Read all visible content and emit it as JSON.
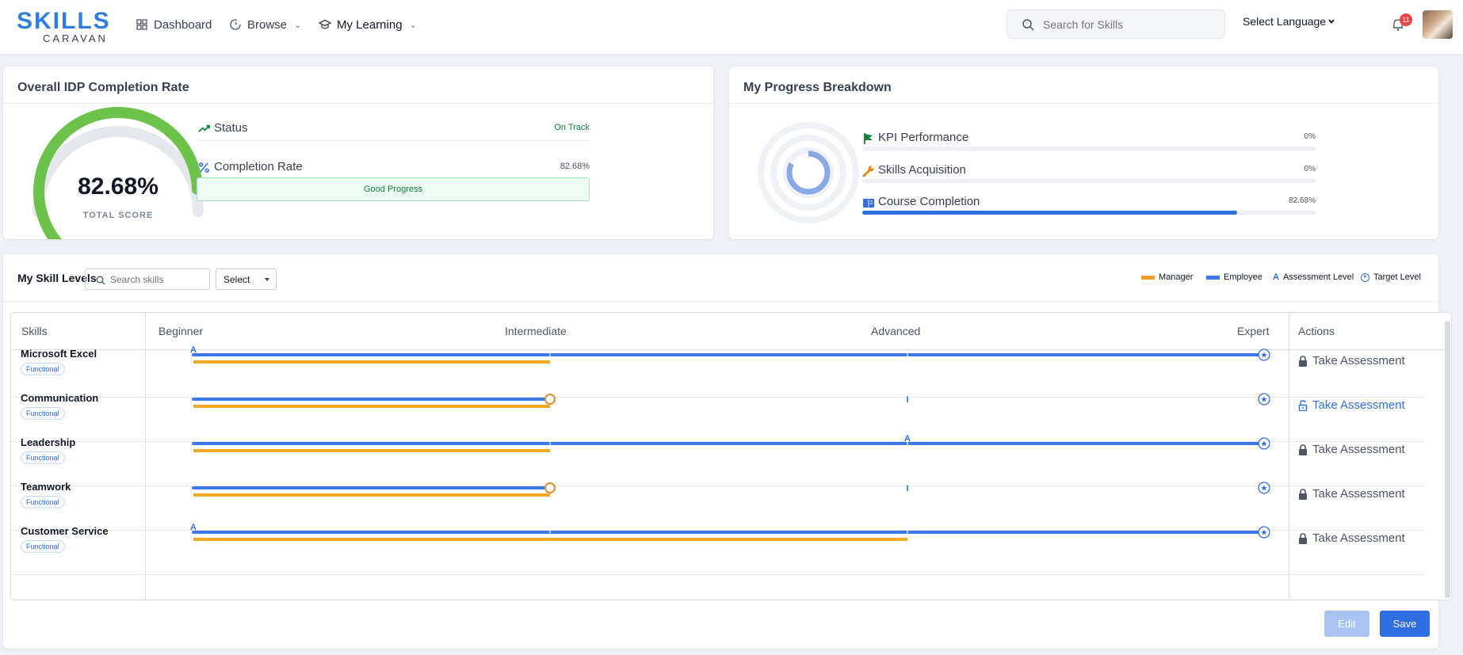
{
  "app": {
    "logo_main": "SKILLS",
    "logo_sub": "CARAVAN"
  },
  "nav": {
    "dashboard": "Dashboard",
    "browse": "Browse",
    "my_learning": "My Learning"
  },
  "header": {
    "search_placeholder": "Search for Skills",
    "language": "Select Language",
    "notification_count": "11"
  },
  "idp": {
    "title": "Overall IDP Completion Rate",
    "score": "82.68%",
    "score_fraction": 0.8268,
    "score_label": "TOTAL SCORE",
    "status_label": "Status",
    "status_value": "On Track",
    "completion_label": "Completion Rate",
    "completion_value": "82.68%",
    "progress_note": "Good Progress"
  },
  "breakdown": {
    "title": "My Progress Breakdown",
    "items": [
      {
        "label": "KPI Performance",
        "value": "0%",
        "fraction": 0,
        "icon": "flag-icon"
      },
      {
        "label": "Skills Acquisition",
        "value": "0%",
        "fraction": 0,
        "icon": "wrench-icon"
      },
      {
        "label": "Course Completion",
        "value": "82.68%",
        "fraction": 0.8268,
        "icon": "book-icon"
      }
    ]
  },
  "skills": {
    "title": "My Skill Levels",
    "search_placeholder": "Search skills",
    "select_label": "Select",
    "legend": {
      "manager": "Manager",
      "employee": "Employee",
      "assessment_mark": "A",
      "assessment": "Assessment Level",
      "target": "Target Level"
    },
    "columns": {
      "skills": "Skills",
      "beginner": "Beginner",
      "intermediate": "Intermediate",
      "advanced": "Advanced",
      "expert": "Expert",
      "actions": "Actions"
    },
    "levels": [
      "Beginner",
      "Intermediate",
      "Advanced",
      "Expert"
    ],
    "rows": [
      {
        "name": "Microsoft Excel",
        "tag": "Functional",
        "employee": "Expert",
        "manager": "Intermediate",
        "assessment": "A",
        "assessment_level": "Beginner",
        "target": "Expert",
        "action": "Take Assessment",
        "action_enabled": false
      },
      {
        "name": "Communication",
        "tag": "Functional",
        "employee": "Intermediate",
        "manager": "Intermediate",
        "assessment": "I",
        "assessment_level": "Advanced",
        "target": "Expert",
        "action": "Take Assessment",
        "action_enabled": true
      },
      {
        "name": "Leadership",
        "tag": "Functional",
        "employee": "Expert",
        "manager": "Intermediate",
        "assessment": "A",
        "assessment_level": "Advanced",
        "target": "Expert",
        "action": "Take Assessment",
        "action_enabled": false
      },
      {
        "name": "Teamwork",
        "tag": "Functional",
        "employee": "Intermediate",
        "manager": "Intermediate",
        "assessment": "I",
        "assessment_level": "Advanced",
        "target": "Expert",
        "action": "Take Assessment",
        "action_enabled": false
      },
      {
        "name": "Customer Service",
        "tag": "Functional",
        "employee": "Expert",
        "manager": "Advanced",
        "assessment": "A",
        "assessment_level": "Beginner",
        "target": "Expert",
        "action": "Take Assessment",
        "action_enabled": false
      }
    ]
  },
  "buttons": {
    "edit": "Edit",
    "save": "Save"
  },
  "colors": {
    "brand": "#2f7de1",
    "employee": "#3b78e7",
    "manager": "#f5a623",
    "gauge": "#6cc24a",
    "good": "#15803d"
  }
}
